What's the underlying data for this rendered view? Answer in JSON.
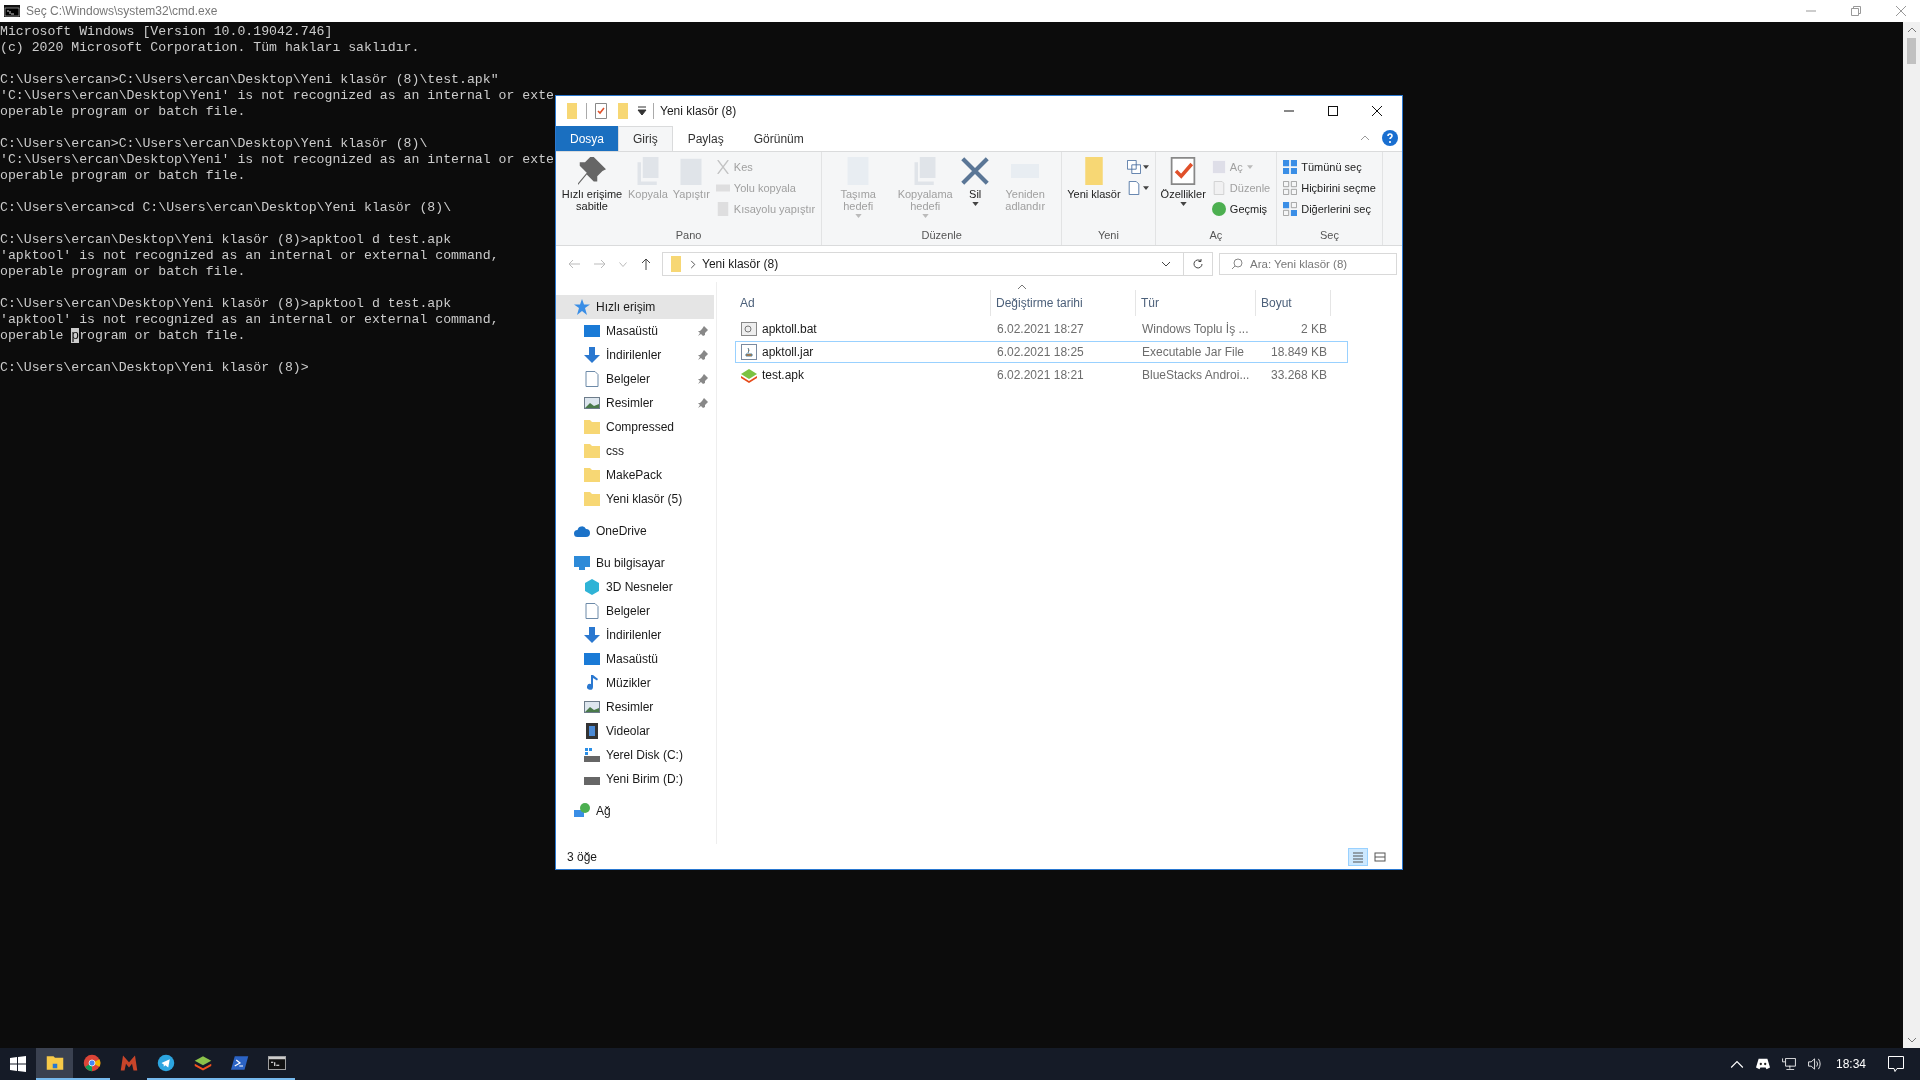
{
  "console_window": {
    "title": "Seç C:\\Windows\\system32\\cmd.exe",
    "blocks": [
      [
        {
          "text": "Microsoft Windows [Version 10.0.19042.746]"
        },
        {
          "text": "(c) 2020 Microsoft Corporation. Tüm hakları saklıdır."
        }
      ],
      [
        {
          "text": "C:\\Users\\ercan>C:\\Users\\ercan\\Desktop\\Yeni klasör (8)\\test.apk\""
        },
        {
          "text": "'C:\\Users\\ercan\\Desktop\\Yeni' is not recognized as an internal or exte"
        },
        {
          "text": "operable program or batch file."
        }
      ],
      [
        {
          "text": "C:\\Users\\ercan>C:\\Users\\ercan\\Desktop\\Yeni klasör (8)\\"
        },
        {
          "text": "'C:\\Users\\ercan\\Desktop\\Yeni' is not recognized as an internal or exte"
        },
        {
          "text": "operable program or batch file."
        }
      ],
      [
        {
          "text": "C:\\Users\\ercan>cd C:\\Users\\ercan\\Desktop\\Yeni klasör (8)\\"
        }
      ],
      [
        {
          "text": "C:\\Users\\ercan\\Desktop\\Yeni klasör (8)>apktool d test.apk"
        },
        {
          "text": "'apktool' is not recognized as an internal or external command,"
        },
        {
          "text": "operable program or batch file."
        }
      ],
      [
        {
          "text": "C:\\Users\\ercan\\Desktop\\Yeni klasör (8)>apktool d test.apk"
        },
        {
          "text": "'apktool' is not recognized as an internal or external command,"
        },
        {
          "text": "operable ",
          "cursor": "p",
          "rest": "rogram or batch file."
        }
      ],
      [
        {
          "text": "C:\\Users\\ercan\\Desktop\\Yeni klasör (8)>"
        }
      ]
    ]
  },
  "explorer": {
    "title": "Yeni klasör (8)",
    "tabs": [
      {
        "label": "Dosya",
        "kind": "file-menu",
        "selected": false
      },
      {
        "label": "Giriş",
        "kind": "tab",
        "selected": true
      },
      {
        "label": "Paylaş",
        "kind": "tab",
        "selected": false
      },
      {
        "label": "Görünüm",
        "kind": "tab",
        "selected": false
      }
    ],
    "ribbon_groups": [
      {
        "label": "Pano",
        "large": [
          {
            "kind": "pin",
            "label": "Hızlı erişime sabitle",
            "disabled": false,
            "dropdown": false
          },
          {
            "kind": "copy",
            "label": "Kopyala",
            "disabled": true,
            "dropdown": false
          },
          {
            "kind": "paste",
            "label": "Yapıştır",
            "disabled": true,
            "dropdown": false
          }
        ],
        "small": [
          {
            "kind": "cut",
            "label": "Kes",
            "disabled": true,
            "dropdown": false
          },
          {
            "kind": "copy-path",
            "label": "Yolu kopyala",
            "disabled": true,
            "dropdown": false
          },
          {
            "kind": "paste-shortcut",
            "label": "Kısayolu yapıştır",
            "disabled": true,
            "dropdown": false
          }
        ]
      },
      {
        "label": "Düzenle",
        "large": [
          {
            "kind": "move-to",
            "label": "Taşıma hedefi",
            "disabled": true,
            "dropdown": true
          },
          {
            "kind": "copy-to",
            "label": "Kopyalama hedefi",
            "disabled": true,
            "dropdown": true
          },
          {
            "kind": "delete",
            "label": "Sil",
            "disabled": false,
            "dropdown": true
          },
          {
            "kind": "rename",
            "label": "Yeniden adlandır",
            "disabled": true,
            "dropdown": false
          }
        ]
      },
      {
        "label": "Yeni",
        "large": [
          {
            "kind": "new-folder",
            "label": "Yeni klasör",
            "disabled": false,
            "dropdown": false
          }
        ],
        "icons": [
          {
            "kind": "new-item",
            "disabled": false,
            "dropdown": true
          },
          {
            "kind": "easy-access",
            "disabled": false,
            "dropdown": true
          }
        ]
      },
      {
        "label": "Aç",
        "large": [
          {
            "kind": "properties",
            "label": "Özellikler",
            "disabled": false,
            "dropdown": true
          }
        ],
        "small": [
          {
            "kind": "open",
            "label": "Aç",
            "disabled": true,
            "dropdown": true
          },
          {
            "kind": "edit",
            "label": "Düzenle",
            "disabled": true,
            "dropdown": false
          },
          {
            "kind": "history",
            "label": "Geçmiş",
            "disabled": false,
            "dropdown": false
          }
        ]
      },
      {
        "label": "Seç",
        "small": [
          {
            "kind": "select-all",
            "label": "Tümünü seç",
            "disabled": false,
            "dropdown": false
          },
          {
            "kind": "select-none",
            "label": "Hiçbirini seçme",
            "disabled": false,
            "dropdown": false
          },
          {
            "kind": "invert",
            "label": "Diğerlerini seç",
            "disabled": false,
            "dropdown": false
          }
        ]
      }
    ],
    "address": {
      "path": "Yeni klasör (8)"
    },
    "search": {
      "placeholder": "Ara: Yeni klasör (8)"
    },
    "nav": [
      {
        "label": "Hızlı erişim",
        "kind": "quick-access",
        "selected": true,
        "pinned": false,
        "children": [
          {
            "label": "Masaüstü",
            "kind": "desktop",
            "selected": false,
            "pinned": true
          },
          {
            "label": "İndirilenler",
            "kind": "downloads",
            "selected": false,
            "pinned": true
          },
          {
            "label": "Belgeler",
            "kind": "documents",
            "selected": false,
            "pinned": true
          },
          {
            "label": "Resimler",
            "kind": "pictures",
            "selected": false,
            "pinned": true
          },
          {
            "label": "Compressed",
            "kind": "folder",
            "selected": false,
            "pinned": false
          },
          {
            "label": "css",
            "kind": "folder",
            "selected": false,
            "pinned": false
          },
          {
            "label": "MakePack",
            "kind": "folder",
            "selected": false,
            "pinned": false
          },
          {
            "label": "Yeni klasör (5)",
            "kind": "folder",
            "selected": false,
            "pinned": false
          }
        ]
      },
      {
        "label": "OneDrive",
        "kind": "cloud",
        "selected": false,
        "pinned": false
      },
      {
        "label": "Bu bilgisayar",
        "kind": "computer",
        "selected": false,
        "pinned": false,
        "children": [
          {
            "label": "3D Nesneler",
            "kind": "cube",
            "selected": false,
            "pinned": false
          },
          {
            "label": "Belgeler",
            "kind": "documents",
            "selected": false,
            "pinned": false
          },
          {
            "label": "İndirilenler",
            "kind": "downloads",
            "selected": false,
            "pinned": false
          },
          {
            "label": "Masaüstü",
            "kind": "desktop",
            "selected": false,
            "pinned": false
          },
          {
            "label": "Müzikler",
            "kind": "music",
            "selected": false,
            "pinned": false
          },
          {
            "label": "Resimler",
            "kind": "pictures",
            "selected": false,
            "pinned": false
          },
          {
            "label": "Videolar",
            "kind": "videos",
            "selected": false,
            "pinned": false
          },
          {
            "label": "Yerel Disk (C:)",
            "kind": "system-drive",
            "selected": false,
            "pinned": false
          },
          {
            "label": "Yeni Birim (D:)",
            "kind": "drive",
            "selected": false,
            "pinned": false
          }
        ]
      },
      {
        "label": "Ağ",
        "kind": "network",
        "selected": false,
        "pinned": false
      }
    ],
    "columns": [
      "Ad",
      "Değiştirme tarihi",
      "Tür",
      "Boyut"
    ],
    "files": [
      {
        "name": "apktoll.bat",
        "kind": "bat",
        "modified": "6.02.2021 18:27",
        "type": "Windows Toplu İş ...",
        "size": "2 KB",
        "selected": false
      },
      {
        "name": "apktoll.jar",
        "kind": "jar",
        "modified": "6.02.2021 18:25",
        "type": "Executable Jar File",
        "size": "18.849 KB",
        "selected": true
      },
      {
        "name": "test.apk",
        "kind": "apk",
        "modified": "6.02.2021 18:21",
        "type": "BlueStacks Androi...",
        "size": "33.268 KB",
        "selected": false
      }
    ],
    "status": "3 öğe",
    "views": [
      {
        "kind": "details",
        "selected": true
      },
      {
        "kind": "tiles",
        "selected": false
      }
    ]
  },
  "taskbar": {
    "apps": [
      {
        "kind": "explorer",
        "selected": true,
        "running": true
      },
      {
        "kind": "browser",
        "selected": false,
        "running": true
      },
      {
        "kind": "m-app",
        "selected": false,
        "running": false
      },
      {
        "kind": "telegram",
        "selected": false,
        "running": true
      },
      {
        "kind": "bluestacks",
        "selected": false,
        "running": true
      },
      {
        "kind": "powershell",
        "selected": false,
        "running": true
      },
      {
        "kind": "cmd",
        "selected": false,
        "running": true
      }
    ],
    "clock": "18:34"
  }
}
